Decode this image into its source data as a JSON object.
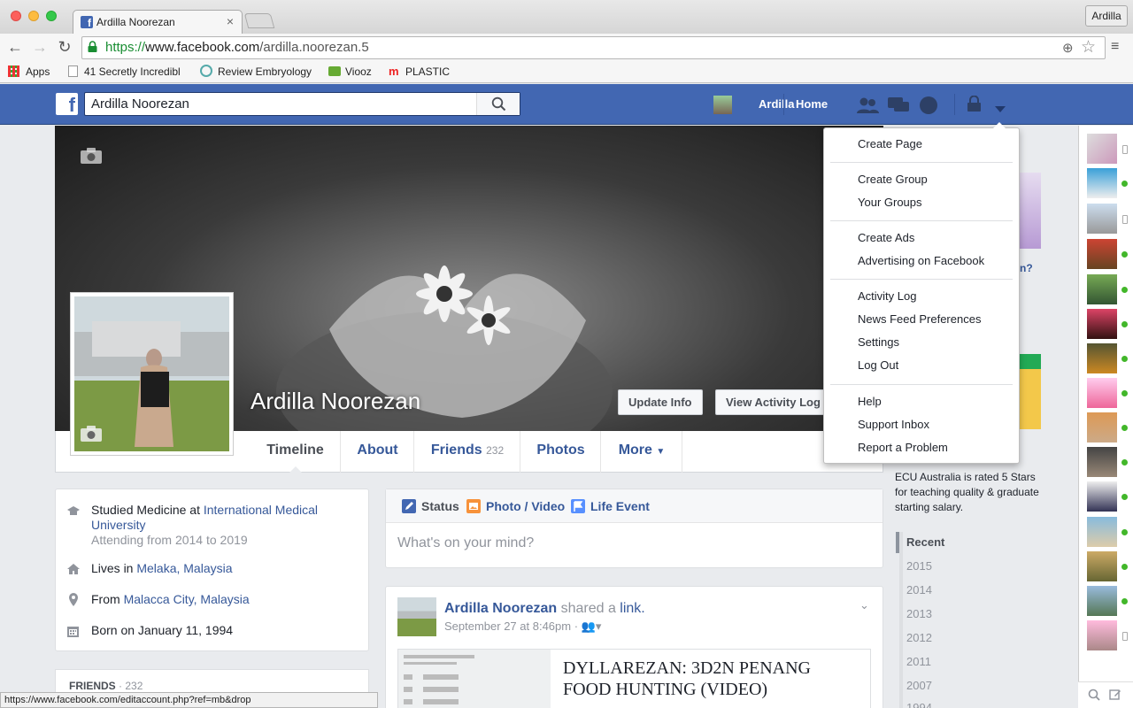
{
  "browser": {
    "tab_title": "Ardilla Noorezan",
    "profile_button": "Ardilla",
    "url_protocol": "https://",
    "url_host": "www.facebook.com",
    "url_path": "/ardilla.noorezan.5",
    "bookmarks": [
      "Apps",
      "41 Secretly Incredibl",
      "Review Embryology",
      "Viooz",
      "PLASTIC"
    ],
    "status_url": "https://www.facebook.com/editaccount.php?ref=mb&drop"
  },
  "header": {
    "search_value": "Ardilla Noorezan",
    "user_label": "Ardilla",
    "home_label": "Home"
  },
  "profile": {
    "name": "Ardilla Noorezan",
    "update_info": "Update Info",
    "view_activity_log": "View Activity Log"
  },
  "timeline_nav": {
    "timeline": "Timeline",
    "about": "About",
    "friends": "Friends",
    "friends_count": "232",
    "photos": "Photos",
    "more": "More"
  },
  "intro": {
    "studied_prefix": "Studied Medicine at ",
    "studied_link": "International Medical University",
    "attending": "Attending from 2014 to 2019",
    "lives_prefix": "Lives in ",
    "lives_link": "Melaka, Malaysia",
    "from_prefix": "From ",
    "from_link": "Malacca City, Malaysia",
    "born": "Born on January 11, 1994",
    "friends_heading": "FRIENDS",
    "friends_count": "· 232"
  },
  "composer": {
    "status": "Status",
    "photo_video": "Photo / Video",
    "life_event": "Life Event",
    "placeholder": "What's on your mind?"
  },
  "post": {
    "author": "Ardilla Noorezan",
    "action": " shared a ",
    "action_link": "link.",
    "timestamp": "September 27 at 8:46pm · ",
    "link_title": "DYLLAREZAN: 3D2N PENANG FOOD HUNTING (VIDEO)"
  },
  "right": {
    "ad_text": "ECU Australia is rated 5 Stars for teaching quality & graduate starting salary.",
    "years": [
      "Recent",
      "2015",
      "2014",
      "2013",
      "2012",
      "2011",
      "2007",
      "1994"
    ]
  },
  "menu": {
    "groups": [
      [
        "Create Page"
      ],
      [
        "Create Group",
        "Your Groups"
      ],
      [
        "Create Ads",
        "Advertising on Facebook"
      ],
      [
        "Activity Log",
        "News Feed Preferences",
        "Settings",
        "Log Out"
      ],
      [
        "Help",
        "Support Inbox",
        "Report a Problem"
      ]
    ]
  },
  "colors": {
    "fb_blue": "#4267b2",
    "link": "#365899",
    "online": "#42b72a"
  }
}
